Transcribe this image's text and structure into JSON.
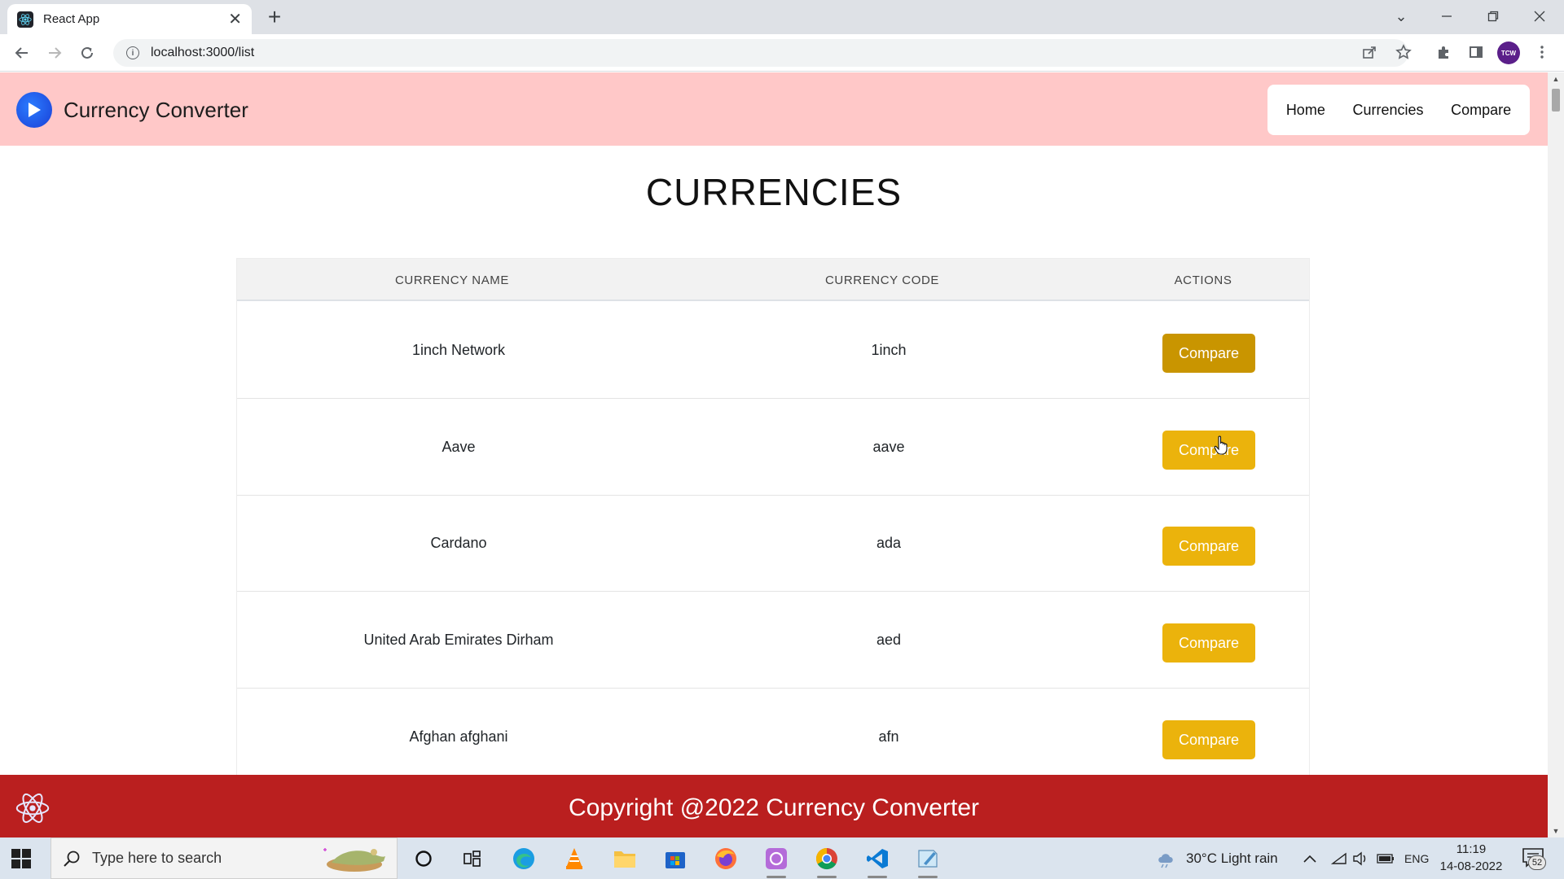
{
  "browser": {
    "tab_title": "React App",
    "tab_close": "✕",
    "new_tab": "+",
    "url": "localhost:3000/list",
    "profile_initials": "TCW"
  },
  "navbar": {
    "brand": "Currency Converter",
    "links": [
      "Home",
      "Currencies",
      "Compare"
    ]
  },
  "page": {
    "title": "CURRENCIES"
  },
  "table": {
    "headers": [
      "CURRENCY NAME",
      "CURRENCY CODE",
      "ACTIONS"
    ],
    "rows": [
      {
        "name": "1inch Network",
        "code": "1inch",
        "action": "Compare"
      },
      {
        "name": "Aave",
        "code": "aave",
        "action": "Compare"
      },
      {
        "name": "Cardano",
        "code": "ada",
        "action": "Compare"
      },
      {
        "name": "United Arab Emirates Dirham",
        "code": "aed",
        "action": "Compare"
      },
      {
        "name": "Afghan afghani",
        "code": "afn",
        "action": "Compare"
      }
    ]
  },
  "footer": {
    "text": "Copyright @2022 Currency Converter"
  },
  "taskbar": {
    "search_placeholder": "Type here to search",
    "weather": "30°C  Light rain",
    "language": "ENG",
    "time": "11:19",
    "date": "14-08-2022",
    "notification_count": "52"
  },
  "colors": {
    "navbar_bg": "#ffc8c8",
    "compare_button": "#ebb30c",
    "compare_button_hover": "#c99500",
    "footer_bg": "#ba1f1f"
  }
}
